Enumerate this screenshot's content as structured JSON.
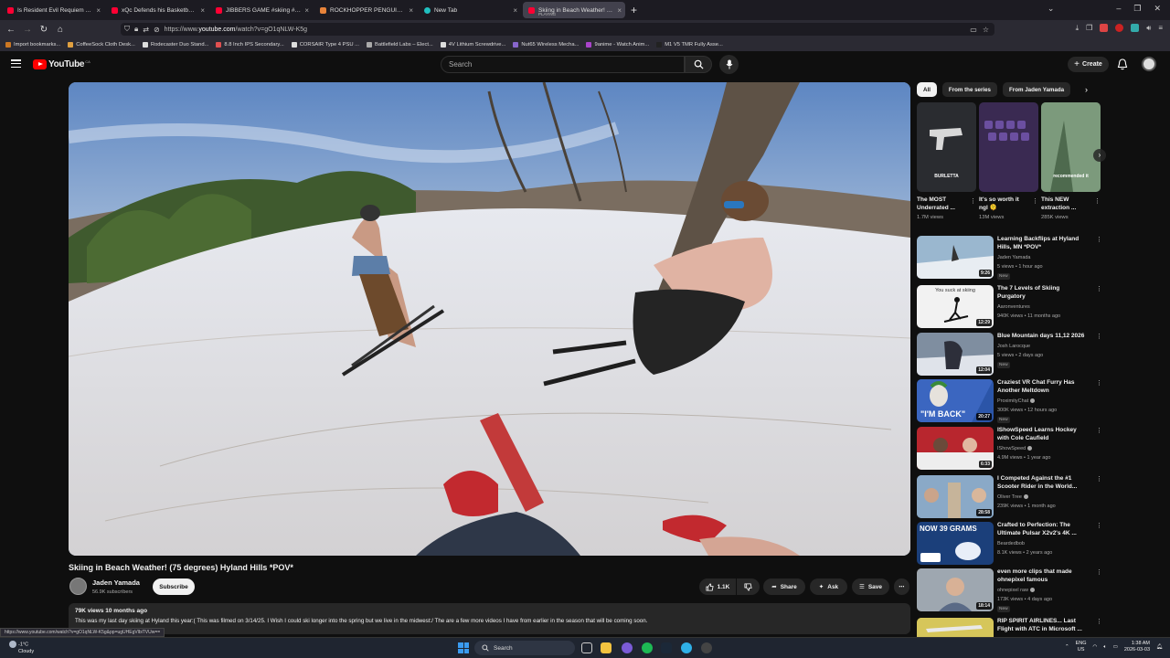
{
  "browser": {
    "tabs": [
      {
        "title": "Is Resident Evil Requiem Good",
        "color": "#ff0033"
      },
      {
        "title": "xQc Defends his Basketball Skil",
        "color": "#ff0033"
      },
      {
        "title": "JIBBERS GAME #skiing #bigair",
        "color": "#ff0033"
      },
      {
        "title": "ROCKHOPPER PENGUIN at Du",
        "color": "#e8833a"
      },
      {
        "title": "New Tab",
        "color": "#20c0c0"
      },
      {
        "title": "Skiing in Beach Weather! (75 de",
        "color": "#ff0033",
        "sub": "PLAYING"
      }
    ],
    "url_prefix": "https://www.",
    "url_domain": "youtube.com",
    "url_path": "/watch?v=gO1qNLW-K5g",
    "bookmarks": [
      {
        "label": "Import bookmarks...",
        "color": "#cc7722"
      },
      {
        "label": "CoffeeSock Cloth Desk...",
        "color": "#e0a040"
      },
      {
        "label": "Rodecaster Duo Stand...",
        "color": "#dddddd"
      },
      {
        "label": "8.8 Inch IPS Secondary...",
        "color": "#e05050"
      },
      {
        "label": "CORSAIR Type 4 PSU ...",
        "color": "#dddddd"
      },
      {
        "label": "Battlefield Labs – Elect...",
        "color": "#aaaaaa"
      },
      {
        "label": "4V Lithium Screwdrive...",
        "color": "#dddddd"
      },
      {
        "label": "Nut65 Wireless Mecha...",
        "color": "#8866cc"
      },
      {
        "label": "9anime - Watch Anim...",
        "color": "#aa44cc"
      },
      {
        "label": "M1 V5 TMR Fully Asse...",
        "color": "#222222"
      }
    ],
    "status_url": "https://www.youtube.com/watch?v=gO1qNLW-K5g&pp=ugUHEgVlbiTVUw=="
  },
  "youtube": {
    "logo_text": "YouTube",
    "logo_region": "CA",
    "search_placeholder": "Search",
    "create_label": "Create"
  },
  "video": {
    "title": "Skiing in Beach Weather! (75 degrees) Hyland Hills *POV*",
    "channel": "Jaden Yamada",
    "subscribers": "56.9K subscribers",
    "subscribe_label": "Subscribe",
    "likes": "1.1K",
    "share_label": "Share",
    "ask_label": "Ask",
    "save_label": "Save",
    "meta": "79K views  10 months ago",
    "description": "This was my last day skiing at Hyland this year:( This was filmed on 3/14/25. I Wish I could ski longer into the spring but we live in the midwest:/ The are a few more videos I have from earlier in the season that will be coming soon."
  },
  "chips": [
    "All",
    "From the series",
    "From Jaden Yamada"
  ],
  "shorts": [
    {
      "title": "The MOST Underrated ...",
      "views": "1.7M views",
      "caption": "BURLETTA",
      "color": "#2a2c30"
    },
    {
      "title": "It's so worth it ngl 🫠",
      "views": "13M views",
      "caption": "",
      "color": "#3a2a52"
    },
    {
      "title": "This NEW extraction ...",
      "views": "285K views",
      "caption": "recommended it",
      "color": "#5f7d62"
    }
  ],
  "recommendations": [
    {
      "title": "Learning Backflips at Hyland Hills, MN *POV*",
      "channel": "Jaden Yamada",
      "verified": false,
      "stats": "5 views • 1 hour ago",
      "badge": "New",
      "duration": "9:26",
      "color": "#9ab7cf"
    },
    {
      "title": "The 7 Levels of Skiing Purgatory",
      "channel": "Aaronventures",
      "verified": false,
      "stats": "940K views • 11 months ago",
      "badge": "",
      "duration": "12:29",
      "color": "#f2f2f2",
      "caption": "You suck at skiing"
    },
    {
      "title": "Blue Mountain days 11,12 2026",
      "channel": "Josh Larocque",
      "verified": false,
      "stats": "5 views • 2 days ago",
      "badge": "New",
      "duration": "12:04",
      "color": "#7f8ea0"
    },
    {
      "title": "Craziest VR Chat Furry Has Another Meltdown",
      "channel": "ProximityChat",
      "verified": true,
      "stats": "300K views • 12 hours ago",
      "badge": "New",
      "duration": "20:27",
      "color": "#2b55a8",
      "caption": "\"I'M BACK\""
    },
    {
      "title": "IShowSpeed Learns Hockey with Cole Caufield",
      "channel": "IShowSpeed",
      "verified": true,
      "stats": "4.9M views • 1 year ago",
      "badge": "",
      "duration": "6:33",
      "color": "#b8262e"
    },
    {
      "title": "I Competed Against the #1 Scooter Rider in the World... ",
      "channel": "Oliver Tree",
      "verified": true,
      "stats": "239K views • 1 month ago",
      "badge": "",
      "duration": "28:58",
      "color": "#6d8fb3"
    },
    {
      "title": "Crafted to Perfection: The Ultimate Pulsar X2v2's 4K ...",
      "channel": "Beardedbob",
      "verified": false,
      "stats": "8.1K views • 2 years ago",
      "badge": "",
      "duration": "",
      "color": "#1b3f7a",
      "caption": "NOW 39 GRAMS"
    },
    {
      "title": "even more clips that made ohnepixel famous",
      "channel": "ohnepixel raw",
      "verified": true,
      "stats": "173K views • 4 days ago",
      "badge": "New",
      "duration": "18:14",
      "color": "#8a7a6a"
    },
    {
      "title": "RIP SPIRIT AIRLINES... Last Flight with ATC in Microsoft ...",
      "channel": "",
      "verified": false,
      "stats": "",
      "badge": "",
      "duration": "",
      "color": "#c9b94a"
    }
  ],
  "taskbar": {
    "temperature": "-1°C",
    "weather": "Cloudy",
    "search_label": "Search",
    "lang1": "ENG",
    "lang2": "US",
    "time": "1:38 AM",
    "date": "2026-03-03"
  }
}
